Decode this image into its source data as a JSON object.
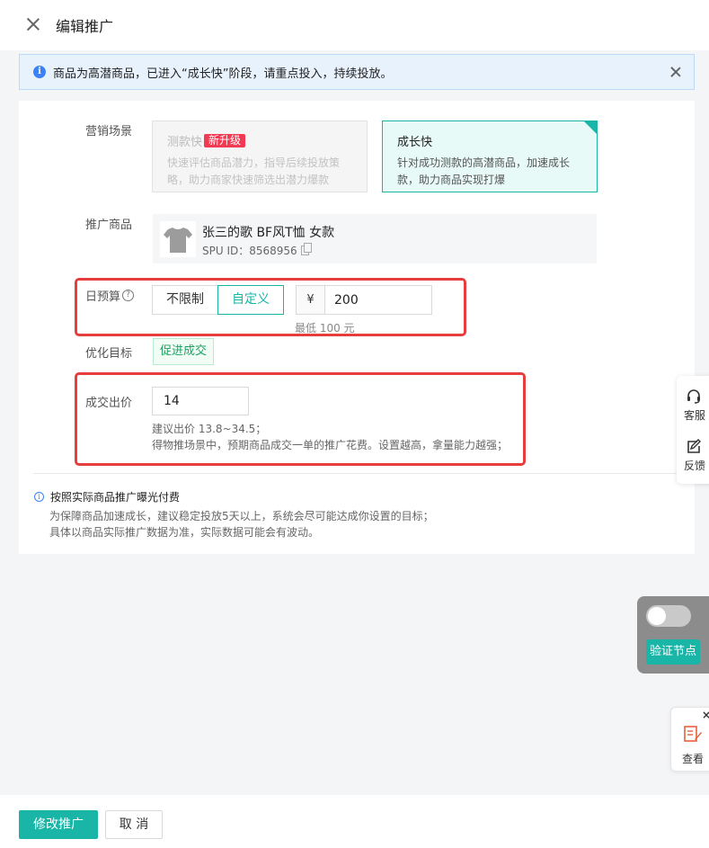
{
  "header": {
    "title": "编辑推广"
  },
  "alert": {
    "text": "商品为高潜商品，已进入“成长快”阶段，请重点投入，持续投放。"
  },
  "form": {
    "scene": {
      "label": "营销场景",
      "options": [
        {
          "name": "测款快",
          "badge": "新升级",
          "desc_line1": "快速评估商品潜力，指导后续投放策",
          "desc_line2": "略，助力商家快速筛选出潜力爆款",
          "state": "disabled"
        },
        {
          "name": "成长快",
          "desc_line1": "针对成功测款的高潜商品，加速成长",
          "desc_line2": "款，助力商品实现打爆",
          "state": "selected"
        }
      ]
    },
    "product": {
      "label": "推广商品",
      "name": "张三的歌 BF风T恤 女款",
      "spu": "SPU ID：8568956"
    },
    "budget": {
      "label": "日预算",
      "help_icon": "?",
      "options": [
        "不限制",
        "自定义"
      ],
      "selected": "自定义",
      "currency": "¥",
      "value": "200",
      "min_hint": "最低 100 元"
    },
    "goal": {
      "label": "优化目标",
      "value": "促进成交"
    },
    "bid": {
      "label": "成交出价",
      "value": "14",
      "hint_line1": "建议出价 13.8~34.5；",
      "hint_line2": "得物推场景中，预期商品成交一单的推广花费。设置越高，拿量能力越强；"
    }
  },
  "note": {
    "icon": "i",
    "title": "按照实际商品推广曝光付费",
    "line1": "为保障商品加速成长，建议稳定投放5天以上，系统会尽可能达成你设置的目标；",
    "line2": "具体以商品实际推广数据为准，实际数据可能会有波动。"
  },
  "side_float": {
    "service_label": "客服",
    "feedback_label": "反馈"
  },
  "debug_panel": {
    "toggle_on": false,
    "button_label": "验证节点"
  },
  "view_float": {
    "label": "查看",
    "close": "×"
  },
  "footer": {
    "submit_label": "修改推广",
    "cancel_label": "取 消"
  },
  "colors": {
    "accent": "#19b5a7",
    "alert_bg": "#e8f2fd",
    "info_blue": "#3b82f6",
    "badge_red": "#f23b52",
    "highlight_red": "#e63d3d"
  }
}
